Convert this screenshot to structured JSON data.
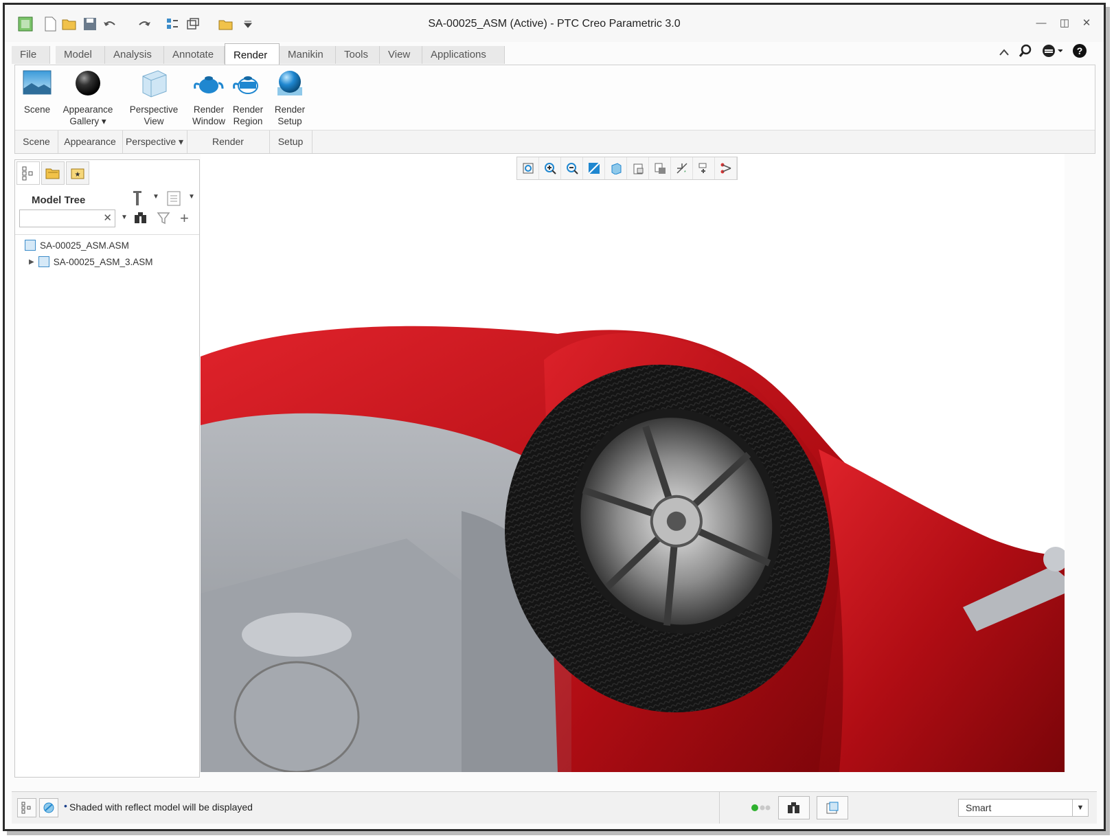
{
  "window": {
    "title": "SA-00025_ASM (Active) - PTC Creo Parametric 3.0",
    "controls": [
      "minimize-icon",
      "restore-icon",
      "close-icon"
    ]
  },
  "quick_access": [
    "app-logo-icon",
    "new-file-icon",
    "open-folder-icon",
    "save-icon",
    "undo-icon",
    "redo-icon",
    "regenerate-icon",
    "windows-icon",
    "close-window-icon",
    "customize-icon"
  ],
  "tabs": [
    "File ▾",
    "Model",
    "Analysis",
    "Annotate",
    "Render",
    "Manikin",
    "Tools",
    "View",
    "Applications"
  ],
  "active_tab": "Render",
  "ribbon": {
    "buttons": {
      "scene": "Scene",
      "appearance_1": "Appearance",
      "appearance_2": "Gallery ▾",
      "perspective_1": "Perspective",
      "perspective_2": "View",
      "render_window_1": "Render",
      "render_window_2": "Window",
      "render_region_1": "Render",
      "render_region_2": "Region",
      "render_setup_1": "Render",
      "render_setup_2": "Setup"
    },
    "groups": {
      "scene": "Scene",
      "appearance": "Appearance",
      "perspective": "Perspective ▾",
      "render": "Render",
      "setup": "Setup"
    }
  },
  "model_tree": {
    "heading": "Model Tree",
    "search_value": "",
    "items": [
      {
        "label": "SA-00025_ASM.ASM"
      },
      {
        "label": "SA-00025_ASM_3.ASM"
      }
    ]
  },
  "view_toolbar": [
    "refit-icon",
    "zoom-in-icon",
    "zoom-out-icon",
    "repaint-icon",
    "display-style-icon",
    "saved-views-icon",
    "view-manager-icon",
    "datum-display-icon",
    "spin-center-icon",
    "annotation-display-icon"
  ],
  "status": {
    "message": "Shaded with reflect model will be displayed",
    "filter": "Smart"
  },
  "colors": {
    "car_body": "#c8141c",
    "grey_part": "#a9acb2",
    "accent_blue": "#3c8cc9"
  }
}
